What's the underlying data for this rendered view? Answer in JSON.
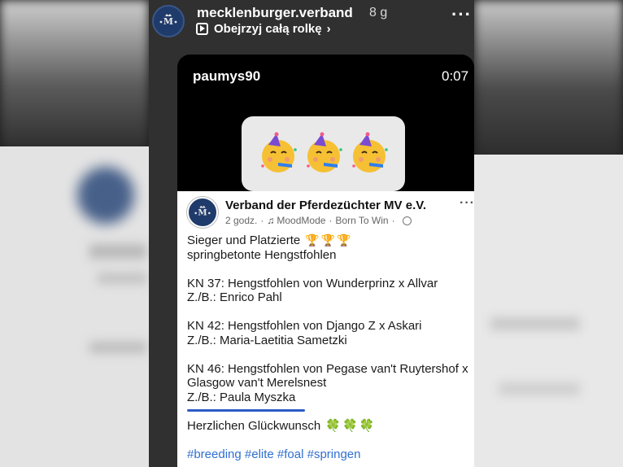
{
  "story": {
    "account": "mecklenburger.verband",
    "time_ago": "8 g",
    "reel_link": "Obejrzyj całą rolkę",
    "more_icon": "ellipsis-icon"
  },
  "video": {
    "username": "paumys90",
    "timestamp": "0:07",
    "emoji_sticker": [
      "partying-face",
      "partying-face",
      "partying-face"
    ]
  },
  "post": {
    "author": "Verband der Pferdezüchter MV e.V.",
    "time": "2 godz.",
    "separator": "·",
    "music": "MoodMode",
    "song": "Born To Win",
    "lines": [
      "Sieger und Platzierte",
      "springbetonte Hengstfohlen",
      "KN 37: Hengstfohlen von Wunderprinz x Allvar",
      "Z./B.: Enrico Pahl",
      "KN 42: Hengstfohlen von Django Z x Askari",
      "Z./B.: Maria-Laetitia Sametzki",
      "KN 46: Hengstfohlen von Pegase van't Ruytershof x",
      "Glasgow van't Merelsnest",
      "Z./B.: Paula Myszka",
      "Herzlichen Glückwunsch",
      "#breeding #elite #foal #springen"
    ],
    "trophy": "🏆",
    "clover": "🍀"
  },
  "colors": {
    "highlight_underline": "#2a5cc4",
    "hashtag": "#2f6fd0",
    "brand_avatar": "#1f3b6b"
  }
}
